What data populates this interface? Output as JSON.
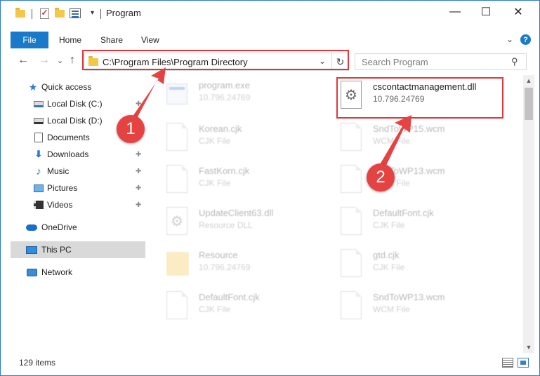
{
  "window": {
    "title": "Program",
    "controls": {
      "minimize": "—",
      "maximize": "☐",
      "close": "✕"
    }
  },
  "ribbon": {
    "tabs": [
      "File",
      "Home",
      "Share",
      "View"
    ],
    "expand_glyph": "⌄",
    "help_glyph": "?"
  },
  "navigation": {
    "back": "←",
    "forward": "→",
    "recent": "⌄",
    "up": "↑",
    "address": "C:\\Program Files\\Program Directory",
    "address_dropdown": "⌄",
    "refresh": "↻",
    "search_placeholder": "Search Program",
    "search_glyph": "⚲"
  },
  "sidebar": {
    "items": [
      {
        "label": "Quick access",
        "icon": "star-icon",
        "pinned": false
      },
      {
        "label": "Local Disk (C:)",
        "icon": "drive-c-icon",
        "pinned": true
      },
      {
        "label": "Local Disk (D:)",
        "icon": "drive-d-icon",
        "pinned": true
      },
      {
        "label": "Documents",
        "icon": "documents-icon",
        "pinned": true
      },
      {
        "label": "Downloads",
        "icon": "downloads-icon",
        "pinned": true
      },
      {
        "label": "Music",
        "icon": "music-icon",
        "pinned": true
      },
      {
        "label": "Pictures",
        "icon": "pictures-icon",
        "pinned": true
      },
      {
        "label": "Videos",
        "icon": "videos-icon",
        "pinned": true
      },
      {
        "label": "OneDrive",
        "icon": "onedrive-icon",
        "pinned": false
      },
      {
        "label": "This PC",
        "icon": "pc-icon",
        "pinned": false,
        "selected": true
      },
      {
        "label": "Network",
        "icon": "network-icon",
        "pinned": false
      }
    ],
    "pin_glyph": "📌"
  },
  "files": [
    {
      "name": "program.exe",
      "sub": "10.796.24769",
      "icon": "exe-icon",
      "faded": true
    },
    {
      "name": "cscontactmanagement.dll",
      "sub": "10.796.24769",
      "icon": "dll-gear-icon",
      "faded": false
    },
    {
      "name": "Korean.cjk",
      "sub": "CJK File",
      "icon": "file-icon",
      "faded": true
    },
    {
      "name": "SndToWP15.wcm",
      "sub": "WCM File",
      "icon": "file-icon",
      "faded": true
    },
    {
      "name": "FastKorn.cjk",
      "sub": "CJK File",
      "icon": "file-icon",
      "faded": true
    },
    {
      "name": "SndToWP13.wcm",
      "sub": "WCM File",
      "icon": "file-icon",
      "faded": true
    },
    {
      "name": "UpdateClient63.dll",
      "sub": "Resource DLL",
      "icon": "dll-gear-icon",
      "faded": true
    },
    {
      "name": "DefaultFont.cjk",
      "sub": "CJK File",
      "icon": "file-icon",
      "faded": true
    },
    {
      "name": "Resource",
      "sub": "10.796.24769",
      "icon": "folder-icon",
      "faded": true
    },
    {
      "name": "gtd.cjk",
      "sub": "CJK File",
      "icon": "file-icon",
      "faded": true
    },
    {
      "name": "DefaultFont.cjk",
      "sub": "CJK File",
      "icon": "file-icon",
      "faded": true
    },
    {
      "name": "SndToWP13.wcm",
      "sub": "WCM File",
      "icon": "file-icon",
      "faded": true
    }
  ],
  "statusbar": {
    "item_count": "129 items"
  },
  "annotations": [
    {
      "number": "1",
      "target": "address-bar"
    },
    {
      "number": "2",
      "target": "cscontactmanagement.dll"
    }
  ],
  "colors": {
    "accent": "#1979ca",
    "highlight_red": "#e0373d",
    "selection_gray": "#d9d9d9"
  }
}
